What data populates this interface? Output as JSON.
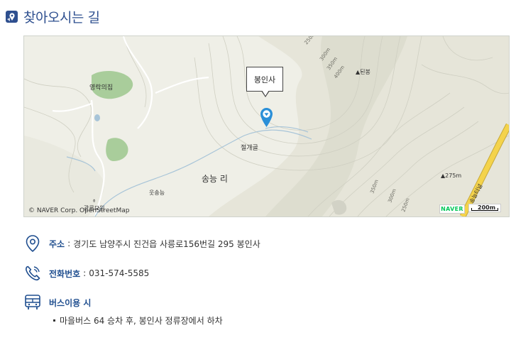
{
  "title": "찾아오시는 길",
  "map": {
    "popup_label": "봉인사",
    "place_labels": {
      "yeongrakuijip": "영락의집",
      "jeolgaegol": "절개골",
      "songneungri": "송능 리",
      "utsongneung": "웃송능",
      "doenbong": "▲된봉",
      "peak275": "▲275m",
      "tunnel": "송능터널",
      "bottom_left": "광릉묘원"
    },
    "contours": [
      "250m",
      "300m",
      "350m",
      "400m",
      "350m",
      "300m",
      "250m"
    ],
    "copyright": "© NAVER Corp. OpenStreetMap",
    "logo": "NAVER",
    "scale": "200m"
  },
  "address": {
    "label": "주소",
    "separator": ":",
    "value": "경기도 남양주시 진건읍 사릉로156번길 295 봉인사"
  },
  "phone": {
    "label": "전화번호",
    "separator": ":",
    "value": "031-574-5585"
  },
  "bus": {
    "label": "버스이용 시",
    "items": [
      "마을버스 64 승차 후, 봉인사 정류장에서 하차"
    ]
  },
  "colors": {
    "accent": "#1f4e8f",
    "title": "#2e4f8f",
    "pin": "#2a8fd8"
  }
}
